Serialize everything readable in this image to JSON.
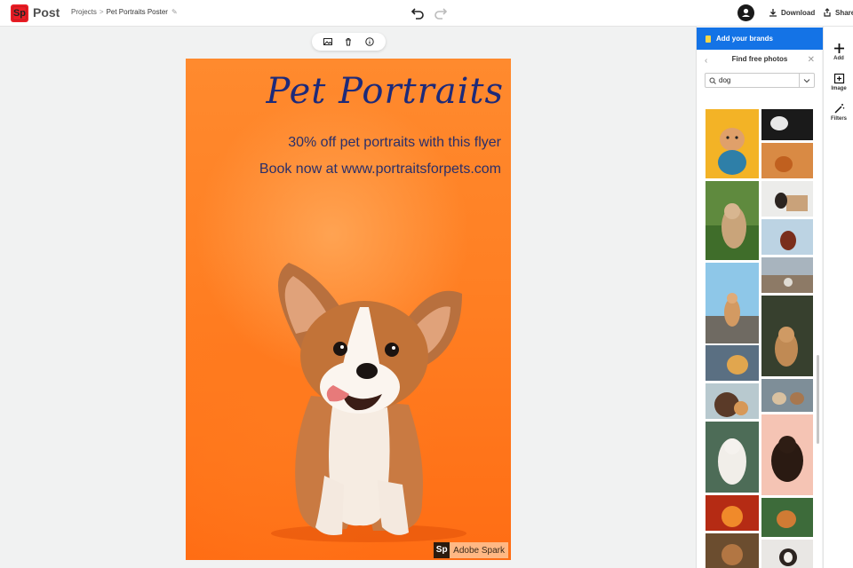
{
  "app": {
    "logo_text": "Sp",
    "product": "Post",
    "breadcrumb": {
      "parent": "Projects",
      "separator": ">",
      "current": "Pet Portraits Poster"
    }
  },
  "toolbar": {
    "download_label": "Download",
    "share_label": "Share"
  },
  "poster": {
    "title": "Pet Portraits",
    "line1": "30% off pet portraits with this flyer",
    "line2": "Book now at www.portraitsforpets.com",
    "badge_logo": "Sp",
    "badge_text": "Adobe Spark",
    "colors": {
      "background": "#ff7e22",
      "title": "#1d2a7a"
    }
  },
  "panel": {
    "brand_label": "Add your brands",
    "header": "Find free photos",
    "search_value": "dog",
    "accent": "#1473e6"
  },
  "rail": [
    {
      "label": "Add",
      "icon": "plus-icon"
    },
    {
      "label": "Image",
      "icon": "image-add-icon"
    },
    {
      "label": "Filters",
      "icon": "magic-wand-icon"
    }
  ]
}
